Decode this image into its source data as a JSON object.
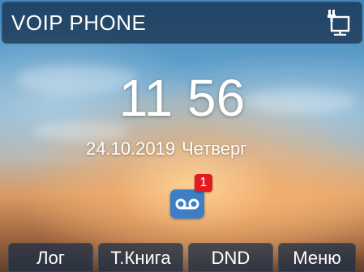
{
  "header": {
    "title": "VOIP  PHONE",
    "network_icon": "ethernet-network-icon"
  },
  "clock": {
    "time": "11 56",
    "date": "24.10.2019",
    "weekday": "Четверг"
  },
  "notifications": {
    "voicemail_icon": "voicemail-icon",
    "voicemail_count": "1"
  },
  "softkeys": [
    {
      "label": "Лог"
    },
    {
      "label": "Т.Книга"
    },
    {
      "label": "DND"
    },
    {
      "label": "Меню"
    }
  ],
  "colors": {
    "bar_background": "#162d46",
    "voicemail_tile": "#3d7fc7",
    "badge": "#e21b23"
  }
}
